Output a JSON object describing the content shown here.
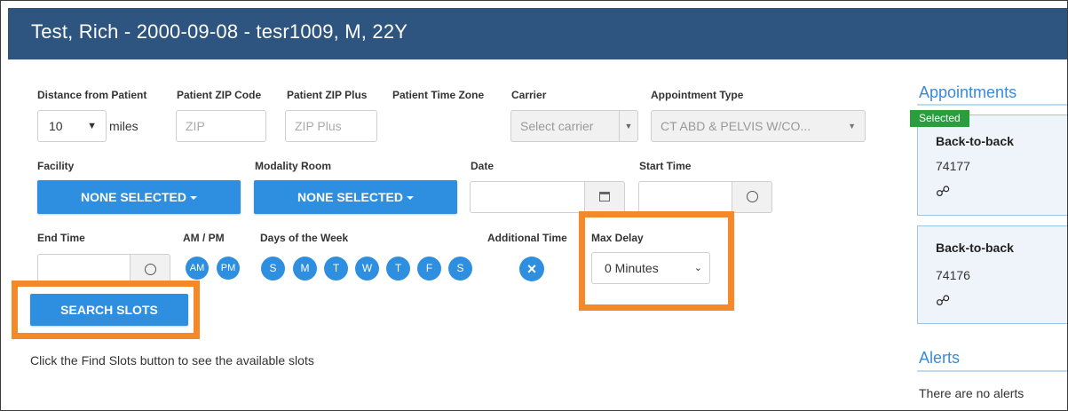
{
  "header": {
    "title": "Test, Rich - 2000-09-08 - tesr1009, M, 22Y"
  },
  "form": {
    "distance_label": "Distance from Patient",
    "distance_value": "10",
    "distance_unit": "miles",
    "zip_label": "Patient ZIP Code",
    "zip_placeholder": "ZIP",
    "zip_plus_label": "Patient ZIP Plus",
    "zip_plus_placeholder": "ZIP Plus",
    "timezone_label": "Patient Time Zone",
    "carrier_label": "Carrier",
    "carrier_placeholder": "Select carrier",
    "appt_type_label": "Appointment Type",
    "appt_type_value": "CT ABD & PELVIS W/CO...",
    "facility_label": "Facility",
    "facility_value": "NONE SELECTED",
    "modality_label": "Modality Room",
    "modality_value": "NONE SELECTED",
    "date_label": "Date",
    "start_time_label": "Start Time",
    "end_time_label": "End Time",
    "ampm_label": "AM / PM",
    "am": "AM",
    "pm": "PM",
    "days_label": "Days of the Week",
    "days": [
      "S",
      "M",
      "T",
      "W",
      "T",
      "F",
      "S"
    ],
    "additional_time_label": "Additional Time",
    "additional_time_icon": "×",
    "max_delay_label": "Max Delay",
    "max_delay_value": "0 Minutes",
    "search_button": "SEARCH SLOTS",
    "hint": "Click the Find Slots button to see the available slots"
  },
  "sidebar": {
    "appointments_title": "Appointments",
    "selected_badge": "Selected",
    "cards": [
      {
        "title": "Back-to-back",
        "code": "74177",
        "icon": "link-icon"
      },
      {
        "title": "Back-to-back",
        "code": "74176",
        "icon": "link-icon"
      }
    ],
    "alerts_title": "Alerts",
    "alerts_text": "There are no alerts"
  },
  "colors": {
    "header": "#2d5580",
    "accent": "#2e8ee0",
    "highlight": "#f5892a",
    "badge": "#2a9d3c"
  }
}
